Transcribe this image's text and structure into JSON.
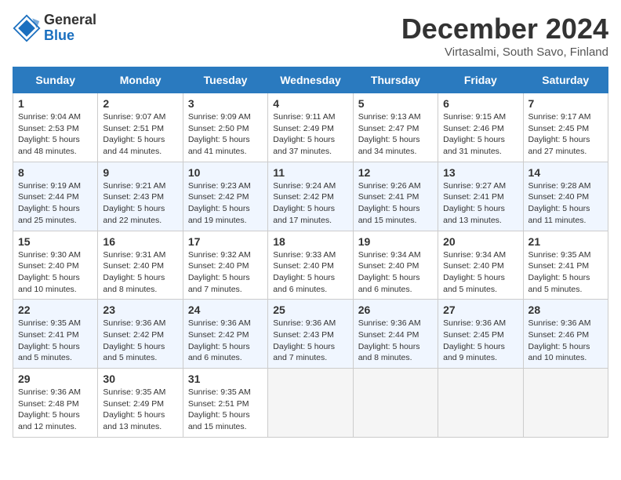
{
  "header": {
    "logo_general": "General",
    "logo_blue": "Blue",
    "month_title": "December 2024",
    "subtitle": "Virtasalmi, South Savo, Finland"
  },
  "calendar": {
    "days_of_week": [
      "Sunday",
      "Monday",
      "Tuesday",
      "Wednesday",
      "Thursday",
      "Friday",
      "Saturday"
    ],
    "weeks": [
      [
        null,
        null,
        null,
        null,
        null,
        null,
        null
      ]
    ],
    "cells": [
      {
        "day": null,
        "empty": true
      },
      {
        "day": null,
        "empty": true
      },
      {
        "day": null,
        "empty": true
      },
      {
        "day": null,
        "empty": true
      },
      {
        "day": null,
        "empty": true
      },
      {
        "day": null,
        "empty": true
      },
      {
        "day": null,
        "empty": true
      }
    ]
  },
  "days": [
    {
      "num": "1",
      "sunrise": "9:04 AM",
      "sunset": "2:53 PM",
      "daylight": "5 hours and 48 minutes."
    },
    {
      "num": "2",
      "sunrise": "9:07 AM",
      "sunset": "2:51 PM",
      "daylight": "5 hours and 44 minutes."
    },
    {
      "num": "3",
      "sunrise": "9:09 AM",
      "sunset": "2:50 PM",
      "daylight": "5 hours and 41 minutes."
    },
    {
      "num": "4",
      "sunrise": "9:11 AM",
      "sunset": "2:49 PM",
      "daylight": "5 hours and 37 minutes."
    },
    {
      "num": "5",
      "sunrise": "9:13 AM",
      "sunset": "2:47 PM",
      "daylight": "5 hours and 34 minutes."
    },
    {
      "num": "6",
      "sunrise": "9:15 AM",
      "sunset": "2:46 PM",
      "daylight": "5 hours and 31 minutes."
    },
    {
      "num": "7",
      "sunrise": "9:17 AM",
      "sunset": "2:45 PM",
      "daylight": "5 hours and 27 minutes."
    },
    {
      "num": "8",
      "sunrise": "9:19 AM",
      "sunset": "2:44 PM",
      "daylight": "5 hours and 25 minutes."
    },
    {
      "num": "9",
      "sunrise": "9:21 AM",
      "sunset": "2:43 PM",
      "daylight": "5 hours and 22 minutes."
    },
    {
      "num": "10",
      "sunrise": "9:23 AM",
      "sunset": "2:42 PM",
      "daylight": "5 hours and 19 minutes."
    },
    {
      "num": "11",
      "sunrise": "9:24 AM",
      "sunset": "2:42 PM",
      "daylight": "5 hours and 17 minutes."
    },
    {
      "num": "12",
      "sunrise": "9:26 AM",
      "sunset": "2:41 PM",
      "daylight": "5 hours and 15 minutes."
    },
    {
      "num": "13",
      "sunrise": "9:27 AM",
      "sunset": "2:41 PM",
      "daylight": "5 hours and 13 minutes."
    },
    {
      "num": "14",
      "sunrise": "9:28 AM",
      "sunset": "2:40 PM",
      "daylight": "5 hours and 11 minutes."
    },
    {
      "num": "15",
      "sunrise": "9:30 AM",
      "sunset": "2:40 PM",
      "daylight": "5 hours and 10 minutes."
    },
    {
      "num": "16",
      "sunrise": "9:31 AM",
      "sunset": "2:40 PM",
      "daylight": "5 hours and 8 minutes."
    },
    {
      "num": "17",
      "sunrise": "9:32 AM",
      "sunset": "2:40 PM",
      "daylight": "5 hours and 7 minutes."
    },
    {
      "num": "18",
      "sunrise": "9:33 AM",
      "sunset": "2:40 PM",
      "daylight": "5 hours and 6 minutes."
    },
    {
      "num": "19",
      "sunrise": "9:34 AM",
      "sunset": "2:40 PM",
      "daylight": "5 hours and 6 minutes."
    },
    {
      "num": "20",
      "sunrise": "9:34 AM",
      "sunset": "2:40 PM",
      "daylight": "5 hours and 5 minutes."
    },
    {
      "num": "21",
      "sunrise": "9:35 AM",
      "sunset": "2:41 PM",
      "daylight": "5 hours and 5 minutes."
    },
    {
      "num": "22",
      "sunrise": "9:35 AM",
      "sunset": "2:41 PM",
      "daylight": "5 hours and 5 minutes."
    },
    {
      "num": "23",
      "sunrise": "9:36 AM",
      "sunset": "2:42 PM",
      "daylight": "5 hours and 5 minutes."
    },
    {
      "num": "24",
      "sunrise": "9:36 AM",
      "sunset": "2:42 PM",
      "daylight": "5 hours and 6 minutes."
    },
    {
      "num": "25",
      "sunrise": "9:36 AM",
      "sunset": "2:43 PM",
      "daylight": "5 hours and 7 minutes."
    },
    {
      "num": "26",
      "sunrise": "9:36 AM",
      "sunset": "2:44 PM",
      "daylight": "5 hours and 8 minutes."
    },
    {
      "num": "27",
      "sunrise": "9:36 AM",
      "sunset": "2:45 PM",
      "daylight": "5 hours and 9 minutes."
    },
    {
      "num": "28",
      "sunrise": "9:36 AM",
      "sunset": "2:46 PM",
      "daylight": "5 hours and 10 minutes."
    },
    {
      "num": "29",
      "sunrise": "9:36 AM",
      "sunset": "2:48 PM",
      "daylight": "5 hours and 12 minutes."
    },
    {
      "num": "30",
      "sunrise": "9:35 AM",
      "sunset": "2:49 PM",
      "daylight": "5 hours and 13 minutes."
    },
    {
      "num": "31",
      "sunrise": "9:35 AM",
      "sunset": "2:51 PM",
      "daylight": "5 hours and 15 minutes."
    }
  ]
}
